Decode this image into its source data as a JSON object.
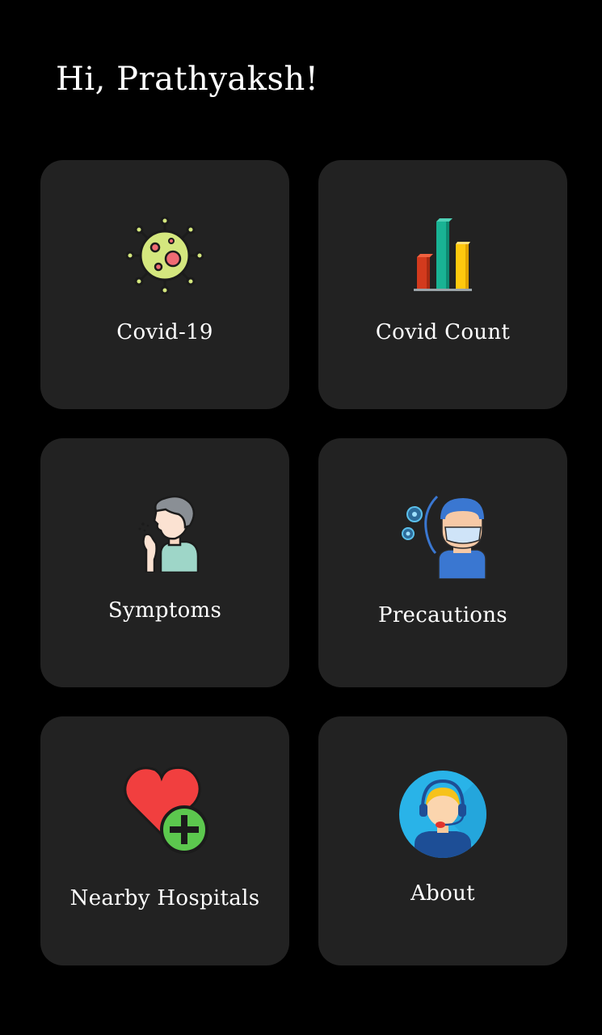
{
  "header": {
    "greeting": "Hi, Prathyaksh!"
  },
  "cards": [
    {
      "label": "Covid-19",
      "icon": "virus-icon"
    },
    {
      "label": "Covid Count",
      "icon": "bar-chart-icon"
    },
    {
      "label": "Symptoms",
      "icon": "coughing-person-icon"
    },
    {
      "label": "Precautions",
      "icon": "masked-person-icon"
    },
    {
      "label": "Nearby Hospitals",
      "icon": "heart-plus-icon"
    },
    {
      "label": "About",
      "icon": "support-agent-icon"
    }
  ],
  "colors": {
    "background": "#000000",
    "card": "#222222",
    "text": "#ffffff"
  }
}
